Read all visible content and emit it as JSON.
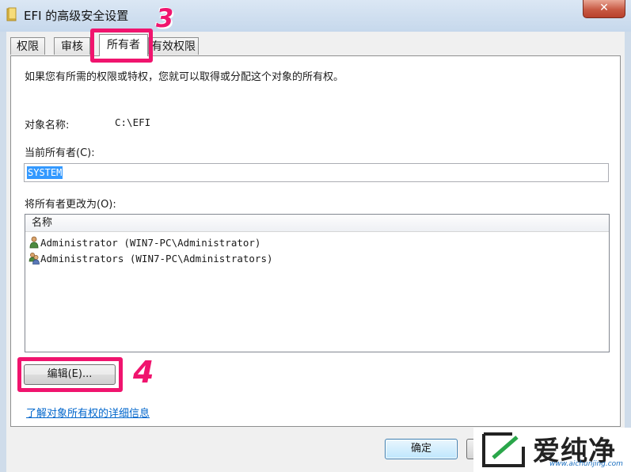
{
  "window": {
    "title": "EFI 的高级安全设置",
    "close_glyph": "✕"
  },
  "tabs": [
    {
      "label": "权限"
    },
    {
      "label": "审核"
    },
    {
      "label": "所有者"
    },
    {
      "label": "有效权限"
    }
  ],
  "active_tab": "所有者",
  "owner_page": {
    "intro": "如果您有所需的权限或特权，您就可以取得或分配这个对象的所有权。",
    "object_name_label": "对象名称:",
    "object_name_value": "C:\\EFI",
    "current_owner_label": "当前所有者(C):",
    "current_owner_value": "SYSTEM",
    "change_owner_label": "将所有者更改为(O):",
    "list_header": "名称",
    "list_items": [
      {
        "name": "Administrator (WIN7-PC\\Administrator)",
        "icon": "user-icon"
      },
      {
        "name": "Administrators (WIN7-PC\\Administrators)",
        "icon": "group-icon"
      }
    ],
    "edit_button": "编辑(E)...",
    "help_link": "了解对象所有权的详细信息"
  },
  "footer": {
    "ok_button": "确定"
  },
  "annotations": {
    "step_tab": "3",
    "step_edit": "4",
    "highlight_color": "#f0146e"
  },
  "watermark": {
    "brand": "爱纯净",
    "url": "www.aichunjing.com"
  }
}
